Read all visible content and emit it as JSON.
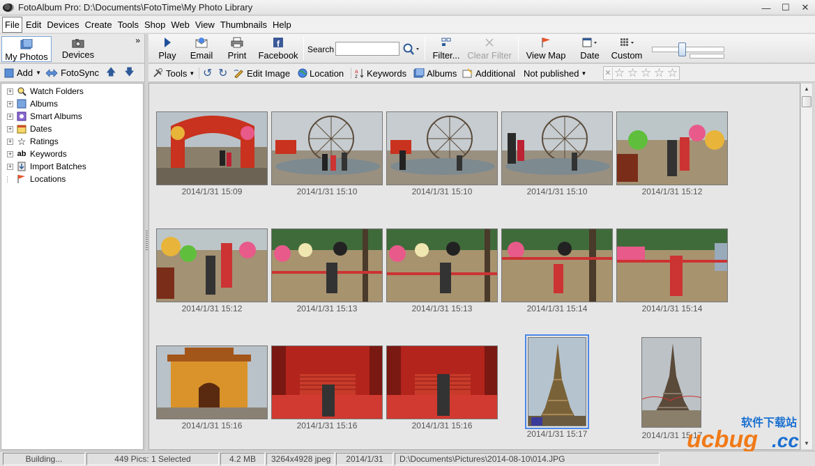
{
  "window": {
    "title": "FotoAlbum Pro:   D:\\Documents\\FotoTime\\My Photo Library"
  },
  "menu": [
    "File",
    "Edit",
    "Devices",
    "Create",
    "Tools",
    "Shop",
    "Web",
    "View",
    "Thumbnails",
    "Help"
  ],
  "left_tabs": {
    "my_photos": "My Photos",
    "devices": "Devices"
  },
  "left_toolbar": {
    "add": "Add",
    "fotosync": "FotoSync"
  },
  "tree": [
    "Watch Folders",
    "Albums",
    "Smart Albums",
    "Dates",
    "Ratings",
    "Keywords",
    "Import Batches",
    "Locations"
  ],
  "toolbar": {
    "play": "Play",
    "email": "Email",
    "print": "Print",
    "facebook": "Facebook",
    "search_label": "Search",
    "search_value": "",
    "filter": "Filter...",
    "clear_filter": "Clear Filter",
    "view_map": "View Map",
    "date": "Date",
    "custom": "Custom"
  },
  "subtoolbar": {
    "tools": "Tools",
    "edit_image": "Edit Image",
    "location": "Location",
    "keywords": "Keywords",
    "albums": "Albums",
    "additional": "Additional",
    "not_published": "Not published"
  },
  "rating": {
    "stars": 0,
    "max": 5
  },
  "thumbnails": [
    "2014/1/31  15:09",
    "2014/1/31  15:10",
    "2014/1/31  15:10",
    "2014/1/31  15:10",
    "2014/1/31  15:12",
    "2014/1/31  15:12",
    "2014/1/31  15:13",
    "2014/1/31  15:13",
    "2014/1/31  15:14",
    "2014/1/31  15:14",
    "2014/1/31  15:16",
    "2014/1/31  15:16",
    "2014/1/31  15:16",
    "2014/1/31  15:17",
    "2014/1/31  15:17"
  ],
  "status": {
    "state": "Building...",
    "count": "449 Pics: 1 Selected",
    "size": "4.2 MB",
    "dims": "3264x4928 jpeg",
    "date": "2014/1/31",
    "path": "D:\\Documents\\Pictures\\2014-08-10\\014.JPG"
  },
  "watermark": {
    "text1": "软件下载站",
    "text2": "ucbug",
    "text3": ".cc"
  }
}
